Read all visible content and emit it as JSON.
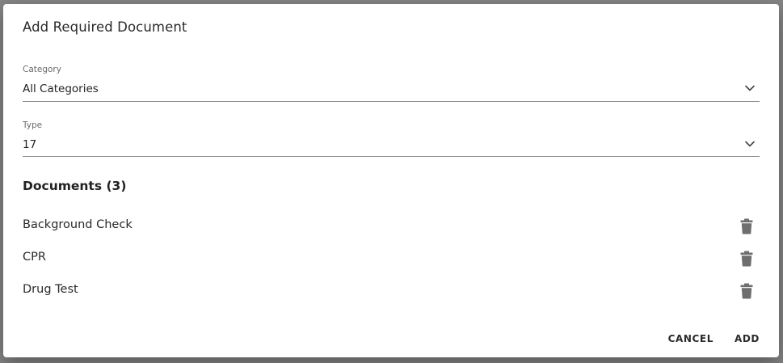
{
  "dialog": {
    "title": "Add Required Document"
  },
  "category": {
    "label": "Category",
    "value": "All Categories",
    "icon": "chevron-down-icon"
  },
  "type": {
    "label": "Type",
    "value": "17",
    "icon": "chevron-down-icon"
  },
  "documents": {
    "heading": "Documents (3)",
    "items": [
      {
        "name": "Background Check",
        "icon": "trash-icon"
      },
      {
        "name": "CPR",
        "icon": "trash-icon"
      },
      {
        "name": "Drug Test",
        "icon": "trash-icon"
      }
    ]
  },
  "actions": {
    "cancel_label": "CANCEL",
    "add_label": "ADD"
  },
  "colors": {
    "backdrop": "#858585",
    "surface": "#ffffff",
    "icon": "#6e6e6e",
    "underline": "#8c8c8c"
  }
}
